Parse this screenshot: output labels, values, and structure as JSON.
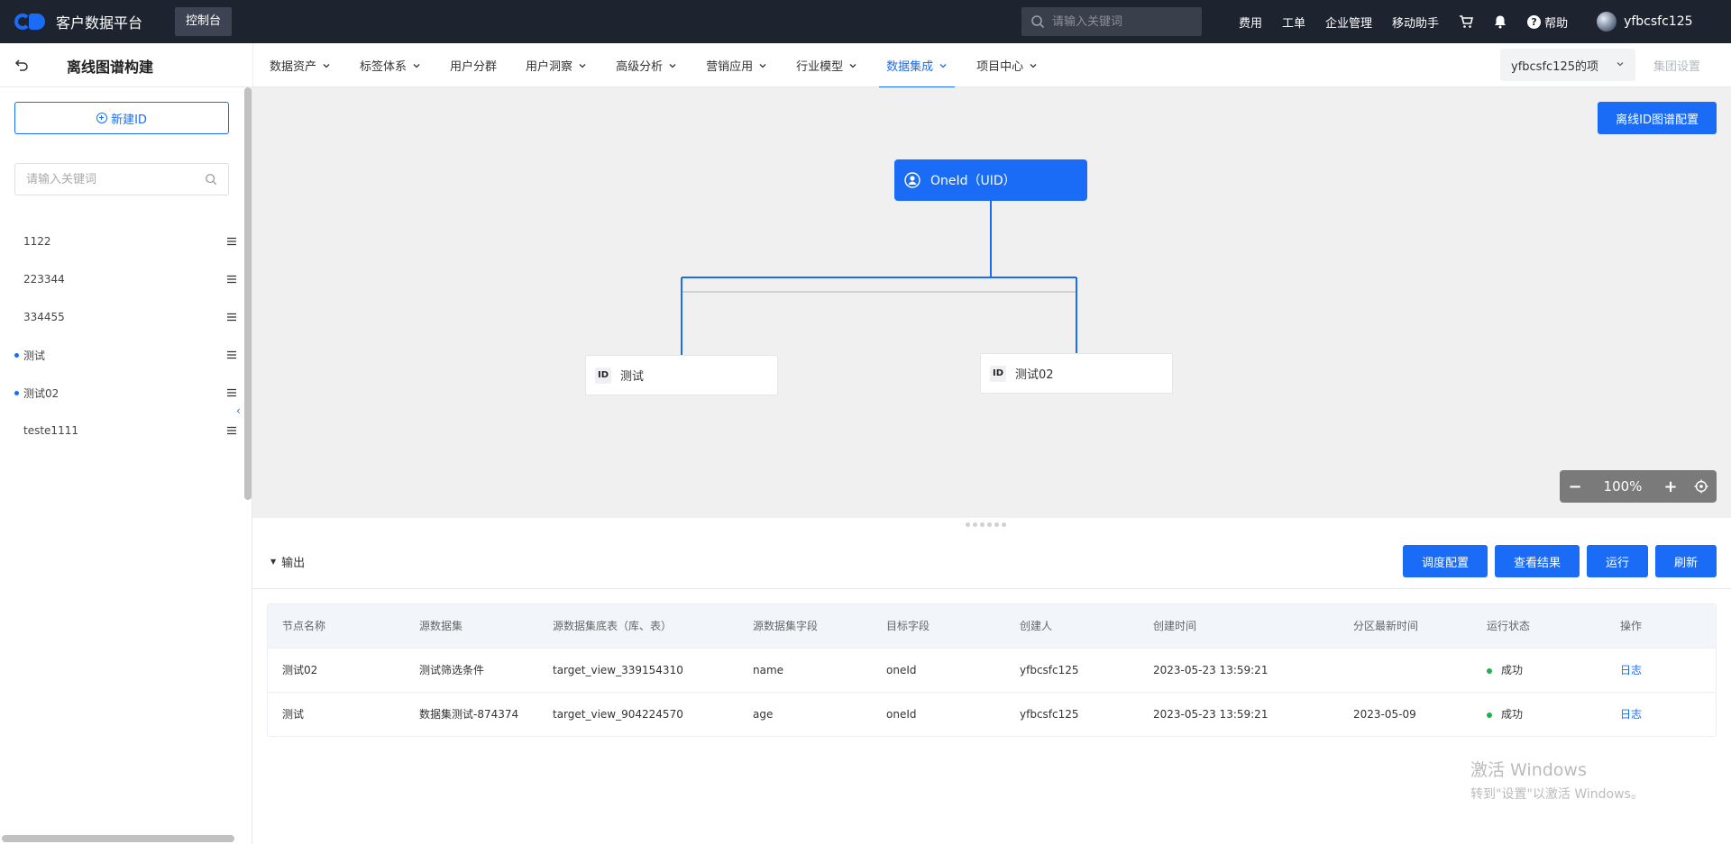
{
  "topbar": {
    "app_name": "客户数据平台",
    "console_label": "控制台",
    "search_placeholder": "请输入关键词",
    "links": [
      "费用",
      "工单",
      "企业管理",
      "移动助手"
    ],
    "help_label": "帮助",
    "user_name": "yfbcsfc125",
    "icons": [
      "search-icon",
      "cart-icon",
      "bell-icon",
      "help-icon"
    ]
  },
  "subheader": {
    "page_title": "离线图谱构建",
    "nav": [
      {
        "label": "数据资产",
        "dropdown": true
      },
      {
        "label": "标签体系",
        "dropdown": true
      },
      {
        "label": "用户分群",
        "dropdown": false
      },
      {
        "label": "用户洞察",
        "dropdown": true
      },
      {
        "label": "高级分析",
        "dropdown": true
      },
      {
        "label": "营销应用",
        "dropdown": true
      },
      {
        "label": "行业模型",
        "dropdown": true
      },
      {
        "label": "数据集成",
        "dropdown": true,
        "active": true
      },
      {
        "label": "项目中心",
        "dropdown": true
      }
    ],
    "project_select": "yfbcsfc125的项",
    "group_setting": "集团设置"
  },
  "sidebar": {
    "new_id_label": "新建ID",
    "search_placeholder": "请输入关键词",
    "items": [
      {
        "label": "1122",
        "dot": false
      },
      {
        "label": "223344",
        "dot": false
      },
      {
        "label": "334455",
        "dot": false
      },
      {
        "label": "测试",
        "dot": true
      },
      {
        "label": "测试02",
        "dot": true
      },
      {
        "label": "teste1111",
        "dot": false
      }
    ]
  },
  "canvas": {
    "config_button": "离线ID图谱配置",
    "root_node": "OneId（UID）",
    "children": [
      {
        "badge": "ID",
        "label": "测试"
      },
      {
        "badge": "ID",
        "label": "测试02"
      }
    ],
    "zoom": "100%"
  },
  "output": {
    "toggle_label": "输出",
    "buttons": [
      "调度配置",
      "查看结果",
      "运行",
      "刷新"
    ],
    "table": {
      "headers": [
        "节点名称",
        "源数据集",
        "源数据集底表（库、表）",
        "源数据集字段",
        "目标字段",
        "创建人",
        "创建时间",
        "分区最新时间",
        "运行状态",
        "操作"
      ],
      "rows": [
        [
          "测试02",
          "测试筛选条件",
          "target_view_339154310",
          "name",
          "oneId",
          "yfbcsfc125",
          "2023-05-23 13:59:21",
          "",
          "成功",
          "日志"
        ],
        [
          "测试",
          "数据集测试-874374",
          "target_view_904224570",
          "age",
          "oneId",
          "yfbcsfc125",
          "2023-05-23 13:59:21",
          "2023-05-09",
          "成功",
          "日志"
        ]
      ]
    }
  },
  "watermark": {
    "line1": "激活 Windows",
    "line2": "转到\"设置\"以激活 Windows。"
  },
  "colors": {
    "topbar_bg": "#1e2330",
    "accent": "#1a6cf6",
    "success": "#22b14c",
    "canvas_bg": "#f0f0f0"
  }
}
